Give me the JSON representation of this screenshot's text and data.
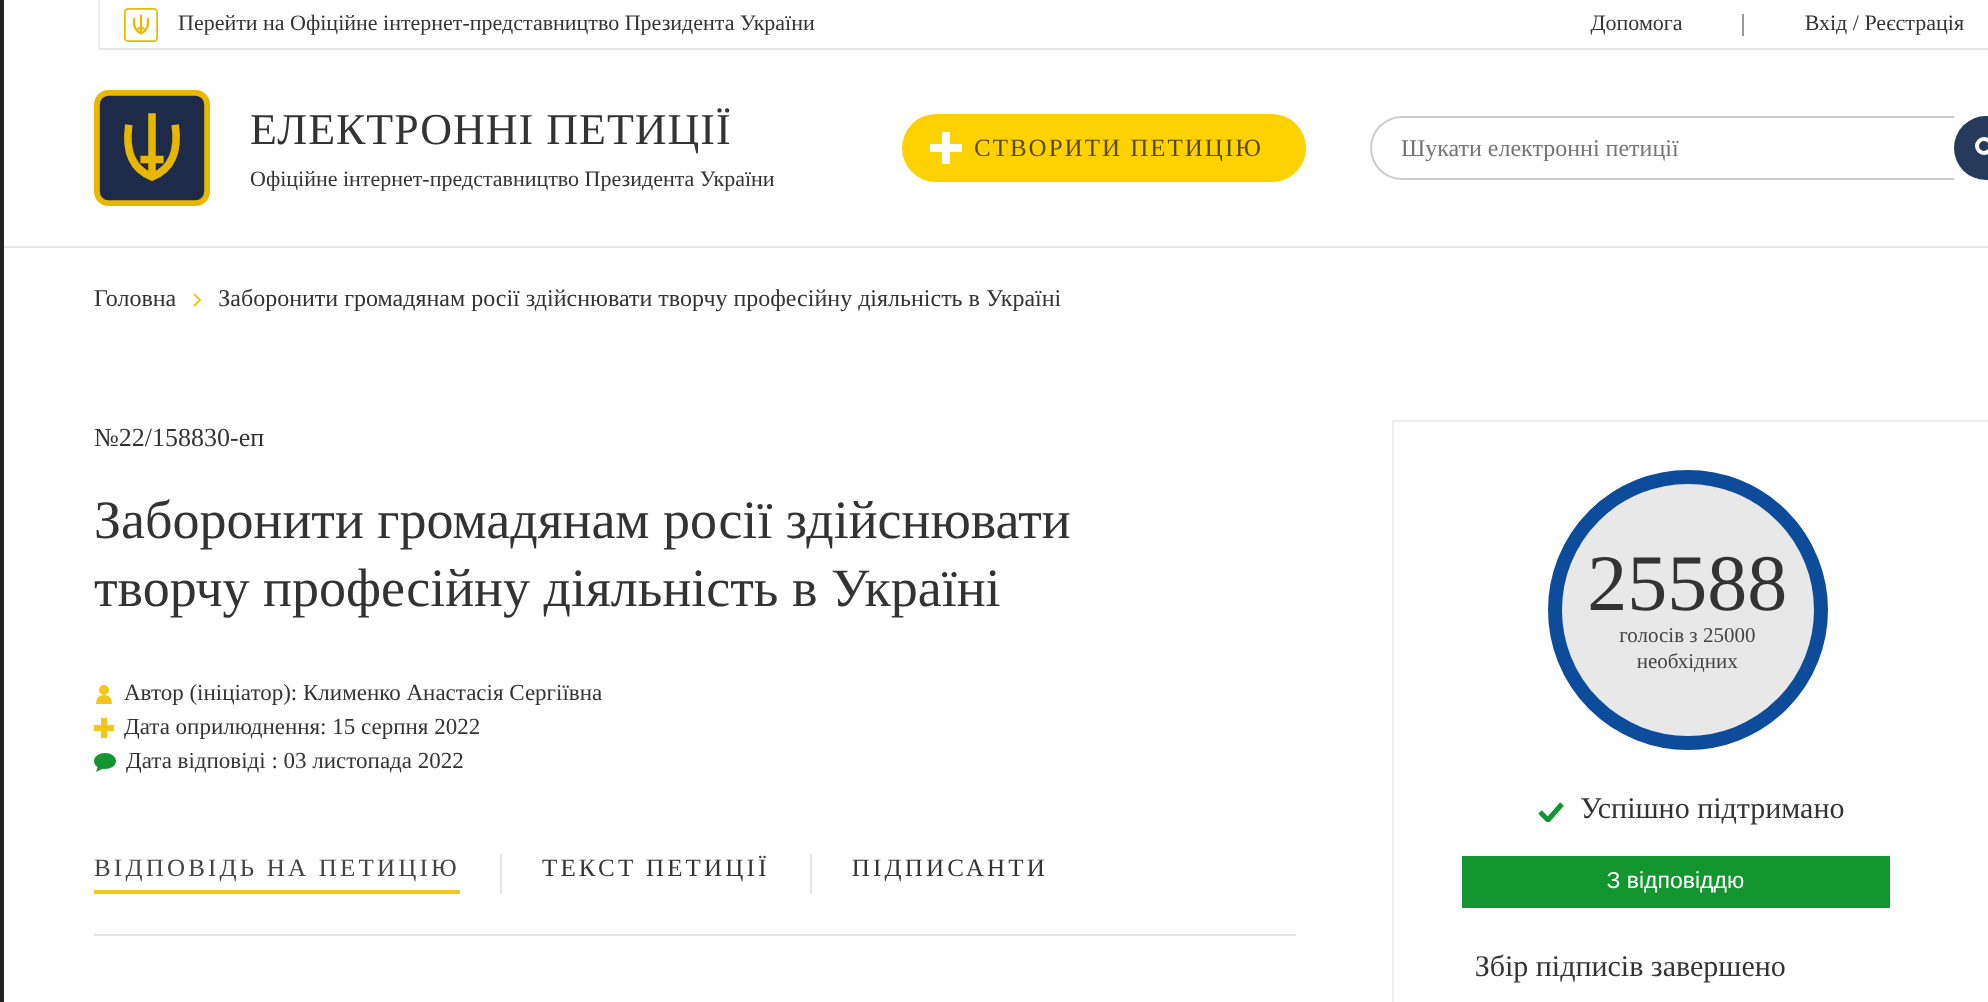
{
  "top_bar": {
    "link": "Перейти на Офіційне інтернет-представництво Президента України",
    "help": "Допомога",
    "login": "Вхід / Реєстрація"
  },
  "header": {
    "title": "ЕЛЕКТРОННІ ПЕТИЦІЇ",
    "subtitle": "Офіційне інтернет-представництво Президента України",
    "create_button": "СТВОРИТИ ПЕТИЦІЮ",
    "search": {
      "placeholder": "Шукати електронні петиції"
    }
  },
  "breadcrumbs": [
    "Головна",
    "Заборонити громадянам росії здійснювати творчу професійну діяльність в Україні"
  ],
  "petition": {
    "number": "№22/158830-еп",
    "title": "Заборонити громадянам росії здійснювати творчу професійну діяльність в Україні",
    "meta": [
      {
        "kind": "author",
        "text": "Автор (ініціатор): Клименко Анастасія Сергіївна"
      },
      {
        "kind": "published",
        "text": "Дата оприлюднення: 15 серпня 2022"
      },
      {
        "kind": "answered",
        "text": "Дата відповіді : 03 листопада 2022"
      }
    ],
    "tabs": [
      {
        "label": "ВІДПОВІДЬ НА ПЕТИЦІЮ",
        "selected": true
      },
      {
        "label": "ТЕКСТ ПЕТИЦІЇ",
        "selected": false
      },
      {
        "label": "ПІДПИСАНТИ",
        "selected": false
      }
    ]
  },
  "votes": {
    "count": "25588",
    "caption": "голосів з 25000 необхідних",
    "status": "Успішно підтримано",
    "badge": "З відповіддю",
    "note": "Збір підписів завершено"
  }
}
